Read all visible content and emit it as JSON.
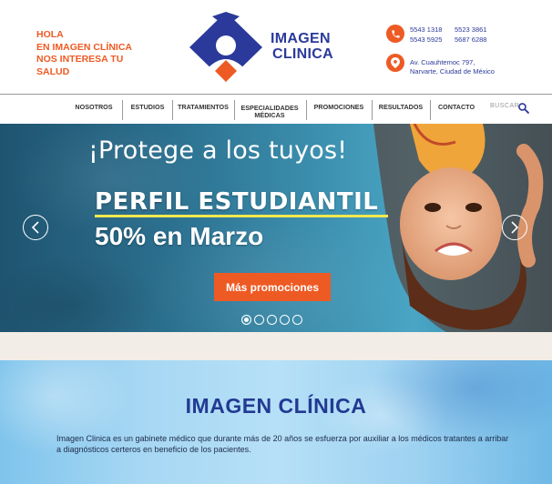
{
  "header": {
    "tagline": [
      "HOLA",
      "EN IMAGEN CLÍNICA",
      "NOS INTERESA TU",
      "SALUD"
    ],
    "logo": {
      "line1": "IMAGEN",
      "line2": "CLINICA"
    },
    "contact": {
      "phones": [
        [
          "5543 1318",
          "5523 3861"
        ],
        [
          "5543 5925",
          "5687 6288"
        ]
      ],
      "address": [
        "Av. Cuauhtemoc 797,",
        "Narvarte, Ciudad de México"
      ],
      "phone_icon": "phone-icon",
      "location_icon": "location-pin-icon"
    }
  },
  "nav": {
    "items": [
      {
        "label": "NOSOTROS"
      },
      {
        "label": "ESTUDIOS"
      },
      {
        "label": "TRATAMIENTOS"
      },
      {
        "label": "ESPECIALIDADES",
        "label2": "MÉDICAS"
      },
      {
        "label": "PROMOCIONES"
      },
      {
        "label": "RESULTADOS"
      },
      {
        "label": "CONTACTO"
      }
    ],
    "search_placeholder": "BUSCAR",
    "search_icon": "search-icon"
  },
  "hero": {
    "headline": "¡Protege a los tuyos!",
    "title": "PERFIL ESTUDIANTIL",
    "subtitle": "50% en Marzo",
    "button": "Más promociones",
    "slide_count": 5,
    "active_slide": 1
  },
  "about": {
    "title": "IMAGEN CLÍNICA",
    "text": "Imagen Clinica es un gabinete médico que durante más de 20 años se esfuerza por auxiliar a los médicos tratantes a arribar a diagnósticos certeros en beneficio de los pacientes."
  },
  "colors": {
    "accent": "#ee5a24",
    "brand_blue": "#2b3a9a",
    "underline": "#f2e94e"
  }
}
